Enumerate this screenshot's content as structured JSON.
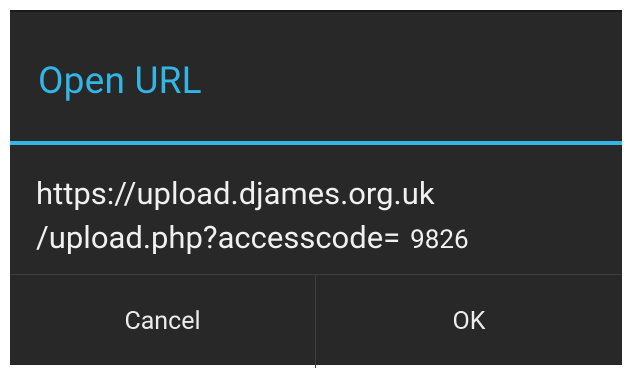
{
  "dialog": {
    "title": "Open URL",
    "message": {
      "line1": "https://upload.djames.org.uk",
      "line2": "/upload.php?accesscode=",
      "code": "9826"
    },
    "buttons": {
      "cancel": "Cancel",
      "ok": "OK"
    }
  },
  "colors": {
    "accent": "#33b5e5",
    "dialog_background": "#282828",
    "text": "#f0f0f0"
  }
}
